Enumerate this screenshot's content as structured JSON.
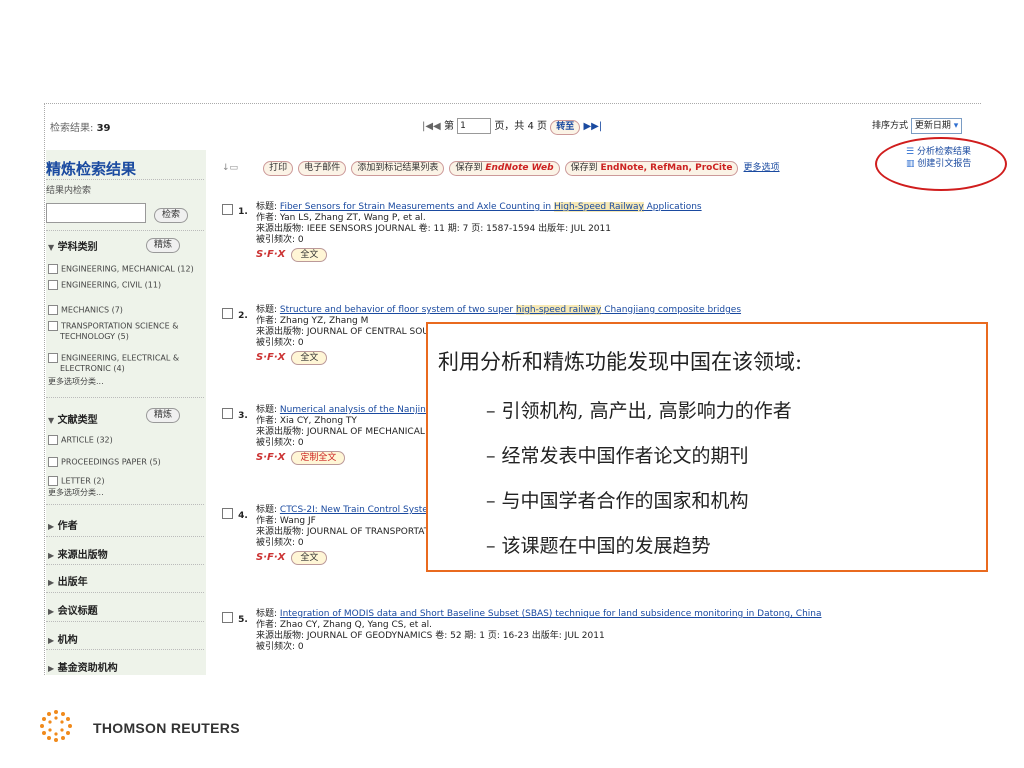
{
  "header": {
    "results_label": "检索结果:",
    "results_count": "39",
    "page_label": "第",
    "page_value": "1",
    "page_total": "页，共 4 页",
    "goto_button": "转至",
    "sort_label": "排序方式",
    "sort_value": "更新日期"
  },
  "toolbar": {
    "print": "打印",
    "email": "电子邮件",
    "add_marked": "添加到标记结果列表",
    "save_to": "保存到",
    "endnote_web": "EndNote Web",
    "save_to2": "保存到",
    "endnote_refman": "EndNote, RefMan, ProCite",
    "more_options": "更多选项",
    "analyze": "分析检索结果",
    "citation_report": "创建引文报告"
  },
  "sidebar": {
    "title": "精炼检索结果",
    "search_within_label": "结果内检索",
    "search_button": "检索",
    "subject": {
      "label": "学科类别",
      "refine": "精炼",
      "items": [
        "ENGINEERING, MECHANICAL (12)",
        "ENGINEERING, CIVIL (11)",
        "MECHANICS (7)",
        "TRANSPORTATION SCIENCE &",
        "TECHNOLOGY (5)",
        "ENGINEERING, ELECTRICAL &",
        "ELECTRONIC (4)"
      ],
      "more": "更多选项分类..."
    },
    "doctype": {
      "label": "文献类型",
      "refine": "精炼",
      "items": [
        "ARTICLE (32)",
        "PROCEEDINGS PAPER (5)",
        "LETTER (2)"
      ],
      "more": "更多选项分类..."
    },
    "collapsed": [
      "作者",
      "来源出版物",
      "出版年",
      "会议标题",
      "机构",
      "基金资助机构"
    ]
  },
  "records": [
    {
      "num": "1.",
      "title_label": "标题:",
      "title_a": "Fiber Sensors for Strain Measurements and Axle Counting in ",
      "title_hl": "High-Speed Railway",
      "title_b": " Applications",
      "authors": "作者: Yan LS, Zhang ZT, Wang P, et al.",
      "source": "来源出版物: IEEE SENSORS JOURNAL  卷: 11  期: 7  页: 1587-1594  出版年: JUL 2011",
      "cited": "被引频次: 0",
      "fulltext": "全文"
    },
    {
      "num": "2.",
      "title_label": "标题:",
      "title_a": "Structure and behavior of floor system of two super ",
      "title_hl": "high-speed railway",
      "title_b": " Changjiang composite bridges",
      "authors": "作者: Zhang YZ, Zhang M",
      "source": "来源出版物: JOURNAL OF CENTRAL SOUT",
      "cited": "被引频次: 0",
      "fulltext": "全文"
    },
    {
      "num": "3.",
      "title_label": "标题:",
      "title_a": "Numerical analysis of the Nanjing",
      "title_hl": "",
      "title_b": "",
      "authors": "作者: Xia CY, Zhong TY",
      "source": "来源出版物: JOURNAL OF MECHANICAL S",
      "cited": "被引频次: 0",
      "fulltext": "定制全文"
    },
    {
      "num": "4.",
      "title_label": "标题:",
      "title_a": "CTCS-2I: New Train Control Syster",
      "title_hl": "",
      "title_b": "",
      "authors": "作者: Wang JF",
      "source": "来源出版物: JOURNAL OF TRANSPORTATI",
      "cited": "被引频次: 0",
      "fulltext": "全文"
    },
    {
      "num": "5.",
      "title_label": "标题:",
      "title_a": "Integration of MODIS data and Short Baseline Subset (SBAS) technique for land subsidence monitoring in Datong, China",
      "title_hl": "",
      "title_b": "",
      "authors": "作者: Zhao CY, Zhang Q, Yang CS, et al.",
      "source": "来源出版物: JOURNAL OF GEODYNAMICS  卷: 52  期: 1  页: 16-23  出版年: JUL 2011",
      "cited": "被引频次: 0",
      "fulltext": ""
    }
  ],
  "sfx_label": "S·F·X",
  "callout": {
    "title": "利用分析和精炼功能发现中国在该领域:",
    "items": [
      "– 引领机构, 高产出, 高影响力的作者",
      "– 经常发表中国作者论文的期刊",
      "– 与中国学者合作的国家和机构",
      "– 该课题在中国的发展趋势"
    ]
  },
  "footer": {
    "logo_text": "THOMSON REUTERS"
  },
  "colors": {
    "accent": "#1a4aa0",
    "callout_border": "#e96a1f",
    "highlight_oval": "#d01d1d"
  }
}
